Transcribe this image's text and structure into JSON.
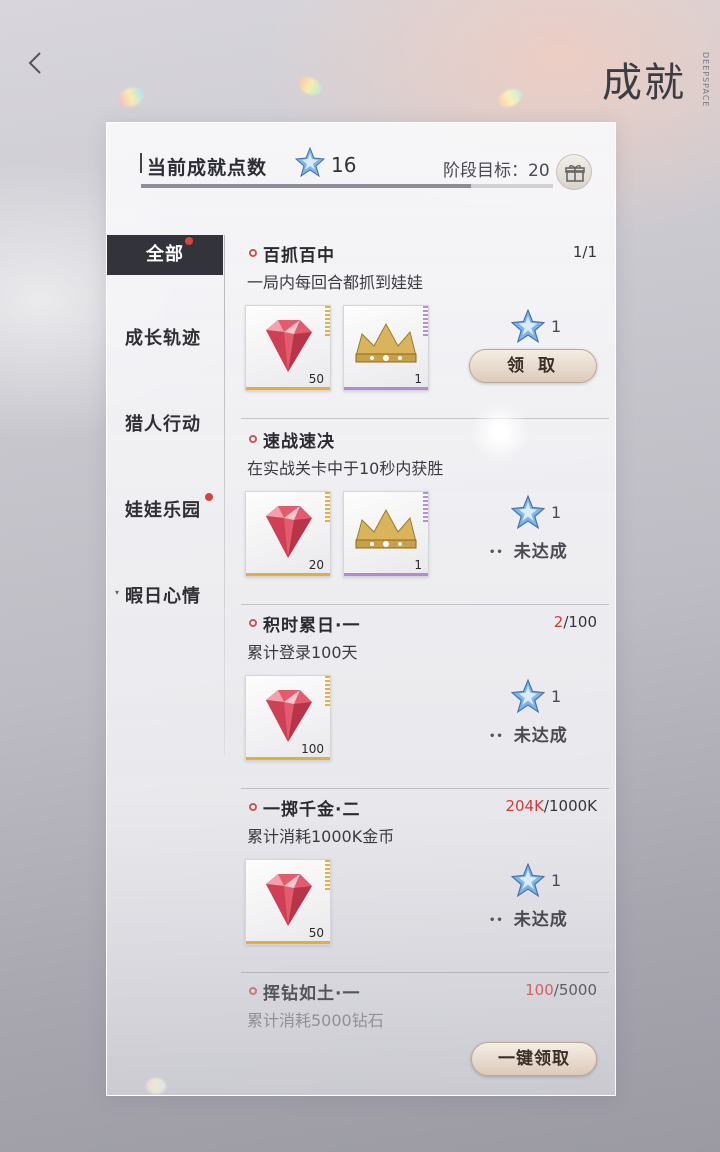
{
  "header": {
    "title": "成就",
    "brand": "DEEPSPACE"
  },
  "summary": {
    "label": "当前成就点数",
    "points": "16",
    "goal_label": "阶段目标：20",
    "progress_fraction": 0.8
  },
  "tabs": [
    {
      "label": "全部",
      "active": true,
      "dot": true
    },
    {
      "label": "成长轨迹",
      "active": false,
      "dot": false
    },
    {
      "label": "猎人行动",
      "active": false,
      "dot": false
    },
    {
      "label": "娃娃乐园",
      "active": false,
      "dot": true
    },
    {
      "label": "暇日心情",
      "active": false,
      "dot": false
    }
  ],
  "achievements": [
    {
      "title": "百抓百中",
      "progress_current": "1",
      "progress_total": "/1",
      "description": "一局内每回合都抓到娃娃",
      "rewards": [
        {
          "item": "gem-icon",
          "qty": "50"
        },
        {
          "item": "crown-icon",
          "qty": "1"
        }
      ],
      "points": "1",
      "action": "领 取"
    },
    {
      "title": "速战速决",
      "progress_current": "",
      "progress_total": "",
      "description": "在实战关卡中于10秒内获胜",
      "rewards": [
        {
          "item": "gem-icon",
          "qty": "20"
        },
        {
          "item": "crown-icon",
          "qty": "1"
        }
      ],
      "points": "1",
      "status": "未达成"
    },
    {
      "title": "积时累日·一",
      "progress_current": "2",
      "progress_total": "/100",
      "description": "累计登录100天",
      "rewards": [
        {
          "item": "gem-icon",
          "qty": "100"
        }
      ],
      "points": "1",
      "status": "未达成"
    },
    {
      "title": "一掷千金·二",
      "progress_current": "204K",
      "progress_total": "/1000K",
      "description": "累计消耗1000K金币",
      "rewards": [
        {
          "item": "gem-icon",
          "qty": "50"
        }
      ],
      "points": "1",
      "status": "未达成"
    },
    {
      "title": "挥钻如土·一",
      "progress_current": "100",
      "progress_total": "/5000",
      "description": "累计消耗5000钻石"
    }
  ],
  "footer": {
    "claim_all": "一键领取"
  },
  "colors": {
    "accent_red": "#d23b35",
    "tab_active_bg": "#33333b",
    "button_bg": "#e8dccd"
  }
}
